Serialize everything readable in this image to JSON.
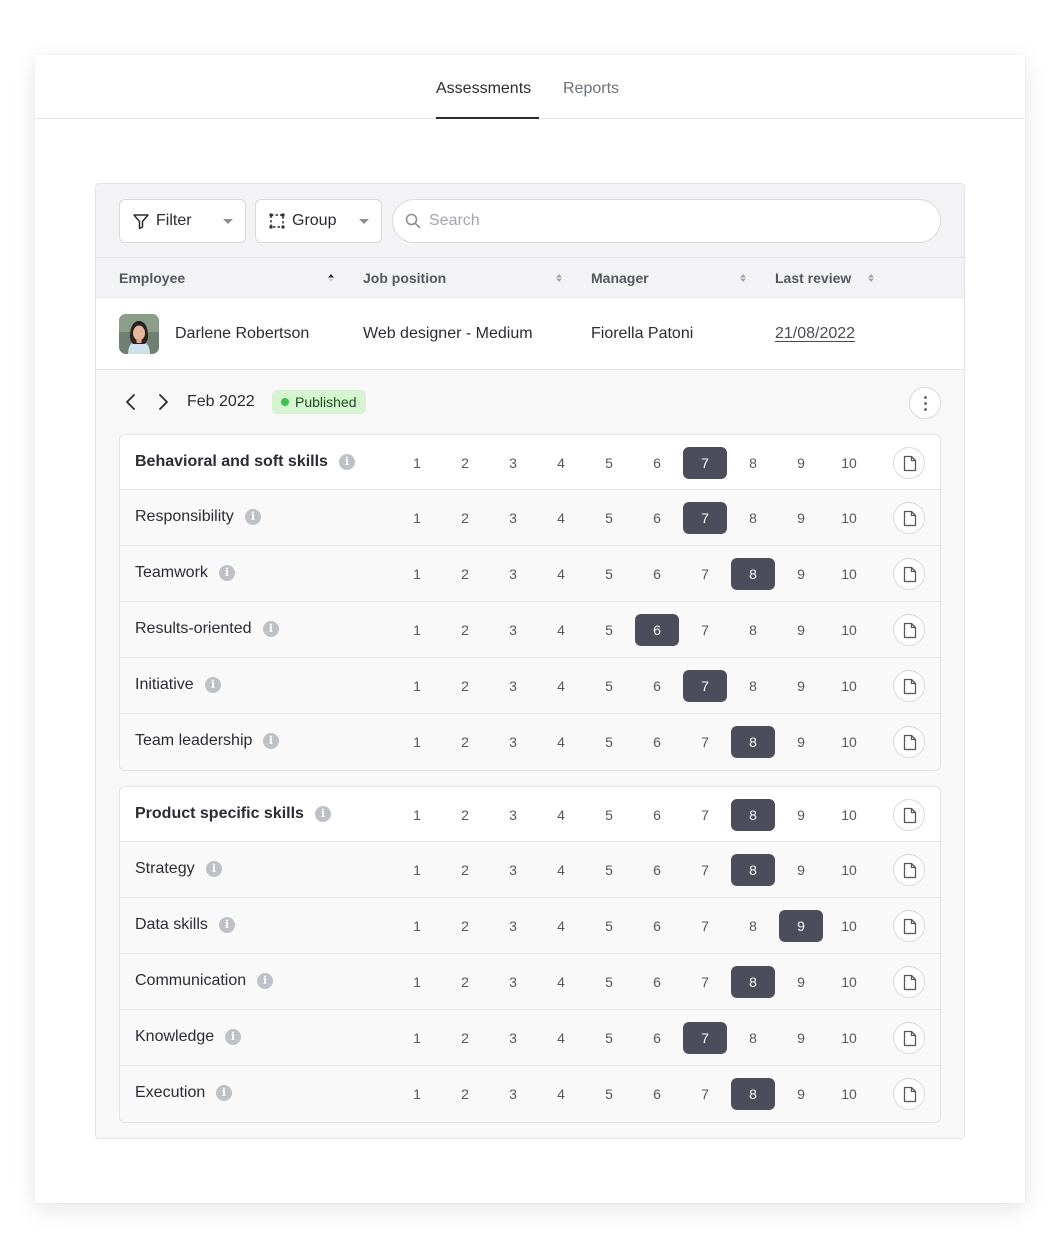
{
  "tabs": [
    {
      "label": "Assessments",
      "active": true
    },
    {
      "label": "Reports",
      "active": false
    }
  ],
  "toolbar": {
    "filter_label": "Filter",
    "group_label": "Group",
    "search_placeholder": "Search"
  },
  "table": {
    "columns": [
      "Employee",
      "Job position",
      "Manager",
      "Last review"
    ],
    "sorted_column": "Employee",
    "row": {
      "employee": "Darlene Robertson",
      "job_position": "Web designer - Medium",
      "manager": "Fiorella Patoni",
      "last_review": "21/08/2022"
    }
  },
  "period": {
    "label": "Feb 2022",
    "status": "Published",
    "status_color": "#3ec04d"
  },
  "scale": [
    "1",
    "2",
    "3",
    "4",
    "5",
    "6",
    "7",
    "8",
    "9",
    "10"
  ],
  "skill_groups": [
    {
      "title": "Behavioral and soft skills",
      "score": 7,
      "skills": [
        {
          "name": "Responsibility",
          "score": 7
        },
        {
          "name": "Teamwork",
          "score": 8
        },
        {
          "name": "Results-oriented",
          "score": 6
        },
        {
          "name": "Initiative",
          "score": 7
        },
        {
          "name": "Team leadership",
          "score": 8
        }
      ]
    },
    {
      "title": "Product specific skills",
      "score": 8,
      "skills": [
        {
          "name": "Strategy",
          "score": 8
        },
        {
          "name": "Data skills",
          "score": 9
        },
        {
          "name": "Communication",
          "score": 8
        },
        {
          "name": "Knowledge",
          "score": 7
        },
        {
          "name": "Execution",
          "score": 8
        }
      ]
    }
  ],
  "colors": {
    "selected_score_bg": "#4b4d5c",
    "badge_bg": "#d6f4d2"
  },
  "icons": [
    "filter-icon",
    "group-icon",
    "search-icon",
    "sort-icon",
    "chevron-left-icon",
    "chevron-right-icon",
    "more-vertical-icon",
    "info-icon",
    "document-icon"
  ]
}
